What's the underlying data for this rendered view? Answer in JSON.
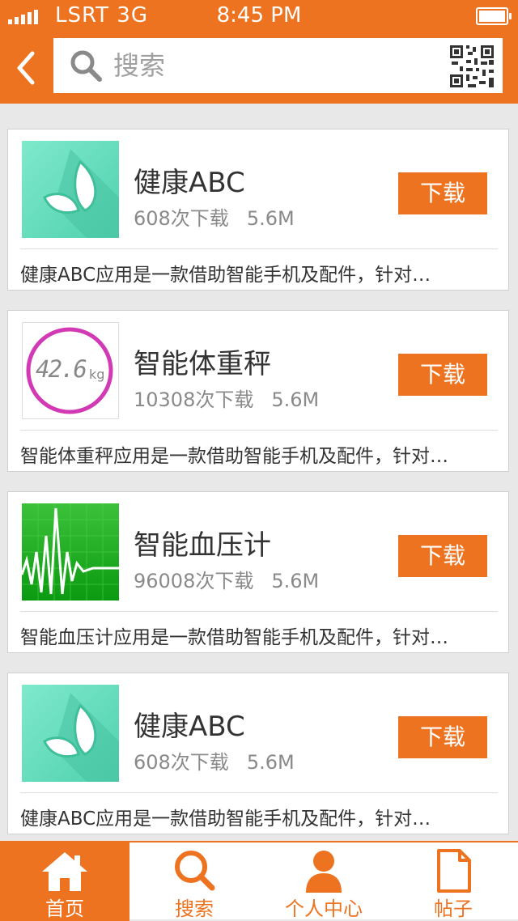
{
  "status_bar": {
    "carrier": "LSRT 3G",
    "time": "8:45 PM"
  },
  "header": {
    "search_placeholder": "搜索",
    "back_icon": "chevron-left-icon",
    "qr_icon": "qr-code-icon"
  },
  "colors": {
    "accent": "#ee7320",
    "background": "#e8e8e8"
  },
  "apps": [
    {
      "name": "健康ABC",
      "downloads": "608次下载",
      "size": "5.6M",
      "button": "下载",
      "description": "健康ABC应用是一款借助智能手机及配件，针对…",
      "icon": "leaf-icon"
    },
    {
      "name": "智能体重秤",
      "downloads": "10308次下载",
      "size": "5.6M",
      "button": "下载",
      "description": "智能体重秤应用是一款借助智能手机及配件，针对…",
      "icon": "scale-icon",
      "icon_text": "42.6",
      "icon_unit": "kg"
    },
    {
      "name": "智能血压计",
      "downloads": "96008次下载",
      "size": "5.6M",
      "button": "下载",
      "description": "智能血压计应用是一款借助智能手机及配件，针对…",
      "icon": "pulse-wave-icon"
    },
    {
      "name": "健康ABC",
      "downloads": "608次下载",
      "size": "5.6M",
      "button": "下载",
      "description": "健康ABC应用是一款借助智能手机及配件，针对…",
      "icon": "leaf-icon"
    }
  ],
  "tabs": [
    {
      "label": "首页",
      "icon": "home-icon",
      "active": true
    },
    {
      "label": "搜索",
      "icon": "search-icon",
      "active": false
    },
    {
      "label": "个人中心",
      "icon": "person-icon",
      "active": false
    },
    {
      "label": "帖子",
      "icon": "document-icon",
      "active": false
    }
  ]
}
